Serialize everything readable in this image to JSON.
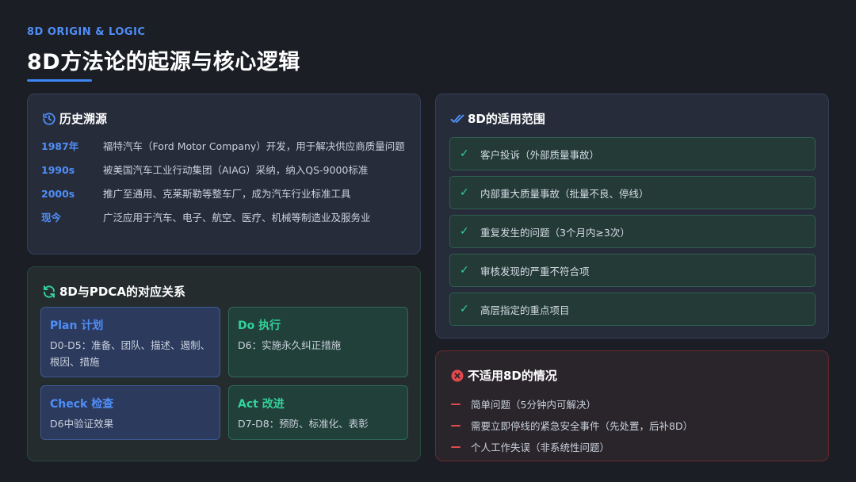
{
  "header": {
    "eyebrow": "8D ORIGIN & LOGIC",
    "title": "8D方法论的起源与核心逻辑"
  },
  "history": {
    "title": "历史溯源",
    "icon": "history-icon",
    "rows": [
      {
        "year": "1987年",
        "desc": "福特汽车（Ford Motor Company）开发，用于解决供应商质量问题"
      },
      {
        "year": "1990s",
        "desc": "被美国汽车工业行动集团（AIAG）采纳，纳入QS-9000标准"
      },
      {
        "year": "2000s",
        "desc": "推广至通用、克莱斯勒等整车厂，成为汽车行业标准工具"
      },
      {
        "year": "现今",
        "desc": "广泛应用于汽车、电子、航空、医疗、机械等制造业及服务业"
      }
    ]
  },
  "pdca": {
    "title": "8D与PDCA的对应关系",
    "icon": "refresh-icon",
    "boxes": [
      {
        "title": "Plan 计划",
        "text": "D0-D5：准备、团队、描述、遏制、根因、措施",
        "color": "blue"
      },
      {
        "title": "Do 执行",
        "text": "D6：实施永久纠正措施",
        "color": "green"
      },
      {
        "title": "Check 检查",
        "text": "D6中验证效果",
        "color": "blue"
      },
      {
        "title": "Act 改进",
        "text": "D7-D8：预防、标准化、表彰",
        "color": "green"
      }
    ]
  },
  "scope": {
    "title": "8D的适用范围",
    "icon": "double-check-icon",
    "items": [
      "客户投诉（外部质量事故）",
      "内部重大质量事故（批量不良、停线）",
      "重复发生的问题（3个月内≥3次）",
      "审核发现的严重不符合项",
      "高层指定的重点项目"
    ]
  },
  "not_applicable": {
    "title": "不适用8D的情况",
    "icon": "close-circle-icon",
    "items": [
      "简单问题（5分钟内可解决）",
      "需要立即停线的紧急安全事件（先处置，后补8D）",
      "个人工作失误（非系统性问题）"
    ]
  },
  "colors": {
    "accent_blue": "#4f8ef7",
    "accent_green": "#33d29a",
    "accent_red": "#e04a4f"
  }
}
